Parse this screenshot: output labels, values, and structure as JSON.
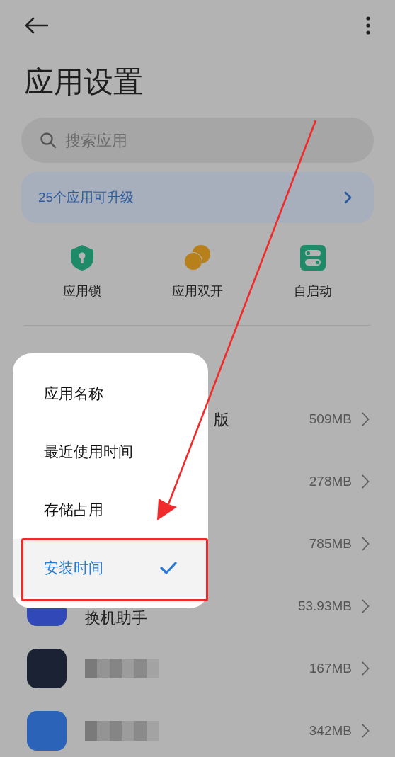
{
  "title": "应用设置",
  "search": {
    "placeholder": "搜索应用"
  },
  "upgrade_banner": {
    "text": "25个应用可升级"
  },
  "shortcuts": [
    {
      "label": "应用锁",
      "kind": "lock"
    },
    {
      "label": "应用双开",
      "kind": "dual"
    },
    {
      "label": "自启动",
      "kind": "autostart"
    }
  ],
  "apps": [
    {
      "name": "版",
      "size": "509MB",
      "blurred": false
    },
    {
      "size": "278MB",
      "blurred": false
    },
    {
      "size": "785MB",
      "blurred": false
    },
    {
      "name": "换机助手",
      "size": "53.93MB",
      "blurred": false,
      "color": "#3048b8"
    },
    {
      "size": "167MB",
      "blurred": true,
      "color": "#1a2233"
    },
    {
      "size": "342MB",
      "blurred": true,
      "color": "#2b63b8"
    }
  ],
  "sort_menu": {
    "items": [
      {
        "label": "应用名称",
        "selected": false
      },
      {
        "label": "最近使用时间",
        "selected": false
      },
      {
        "label": "存储占用",
        "selected": false
      },
      {
        "label": "安装时间",
        "selected": true
      }
    ]
  }
}
